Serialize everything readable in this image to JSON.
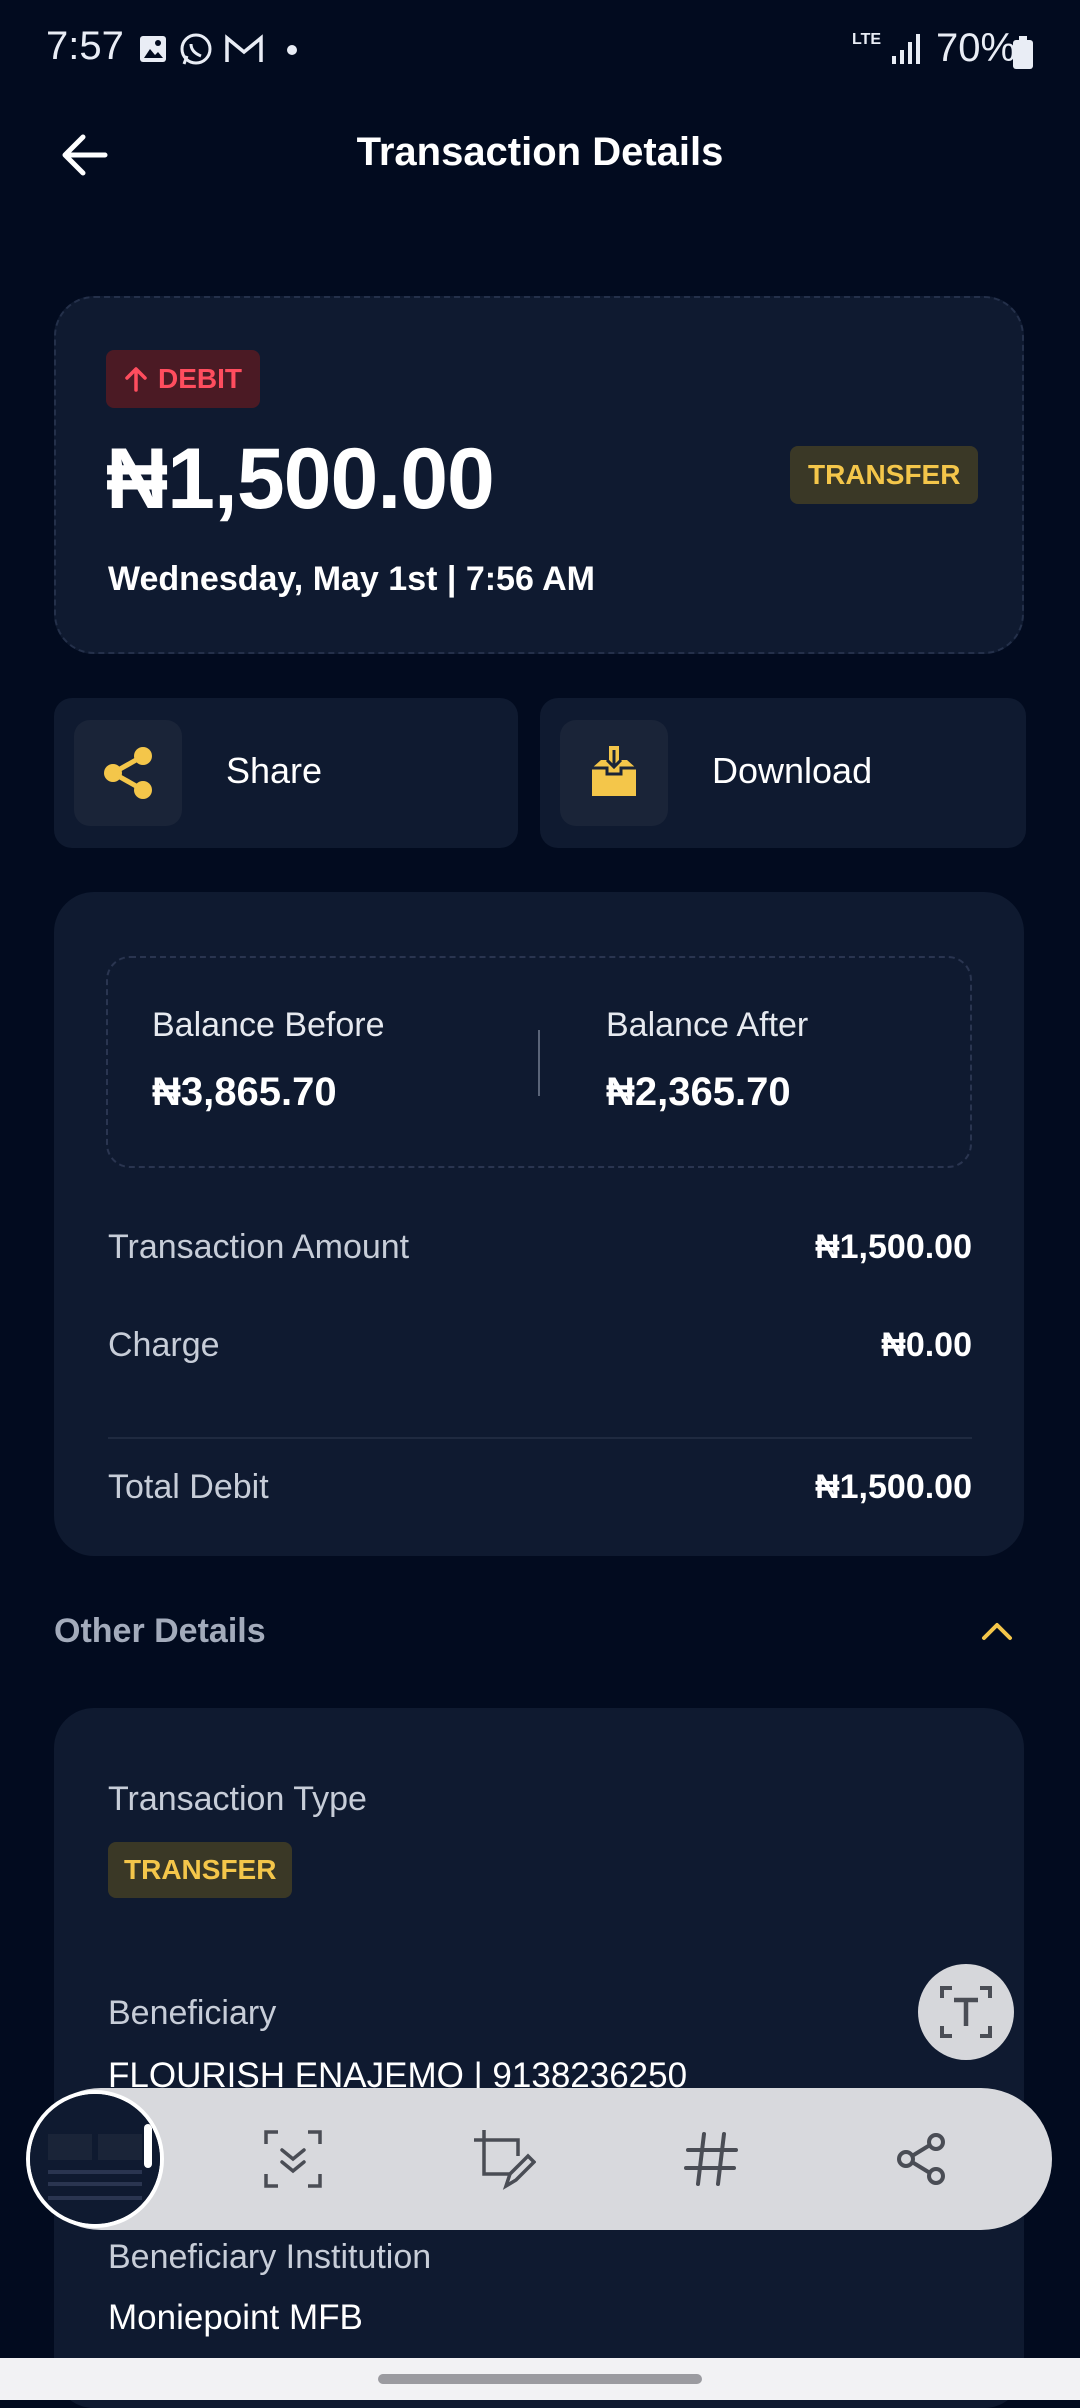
{
  "status_bar": {
    "time": "7:57",
    "network": "LTE",
    "battery": "70%",
    "icons": [
      "gallery-icon",
      "whatsapp-icon",
      "gmail-icon",
      "dot-icon",
      "lte-icon",
      "signal-icon",
      "battery-icon"
    ]
  },
  "header": {
    "title": "Transaction Details",
    "back_icon": "arrow-left-icon"
  },
  "summary": {
    "direction_badge": "DEBIT",
    "amount": "₦1,500.00",
    "type_badge": "TRANSFER",
    "datetime": "Wednesday, May 1st | 7:56 AM"
  },
  "actions": {
    "share_label": "Share",
    "download_label": "Download"
  },
  "balances": {
    "before_label": "Balance Before",
    "before_value": "₦3,865.70",
    "after_label": "Balance After",
    "after_value": "₦2,365.70"
  },
  "breakdown": {
    "amount_label": "Transaction Amount",
    "amount_value": "₦1,500.00",
    "charge_label": "Charge",
    "charge_value": "₦0.00",
    "total_label": "Total Debit",
    "total_value": "₦1,500.00"
  },
  "other_details": {
    "title": "Other Details",
    "type_label": "Transaction Type",
    "type_value": "TRANSFER",
    "beneficiary_label": "Beneficiary",
    "beneficiary_value": "FLOURISH ENAJEMO | 9138236250",
    "institution_label": "Beneficiary Institution",
    "institution_value": "Moniepoint MFB"
  },
  "capture_toolbar": {
    "tools": [
      "scroll-capture-icon",
      "crop-edit-icon",
      "hashtag-icon",
      "share-icon"
    ]
  },
  "colors": {
    "background": "#020b1f",
    "card": "#0f1a30",
    "accent_yellow": "#f4c64a",
    "debit_red": "#ff4d5e"
  }
}
